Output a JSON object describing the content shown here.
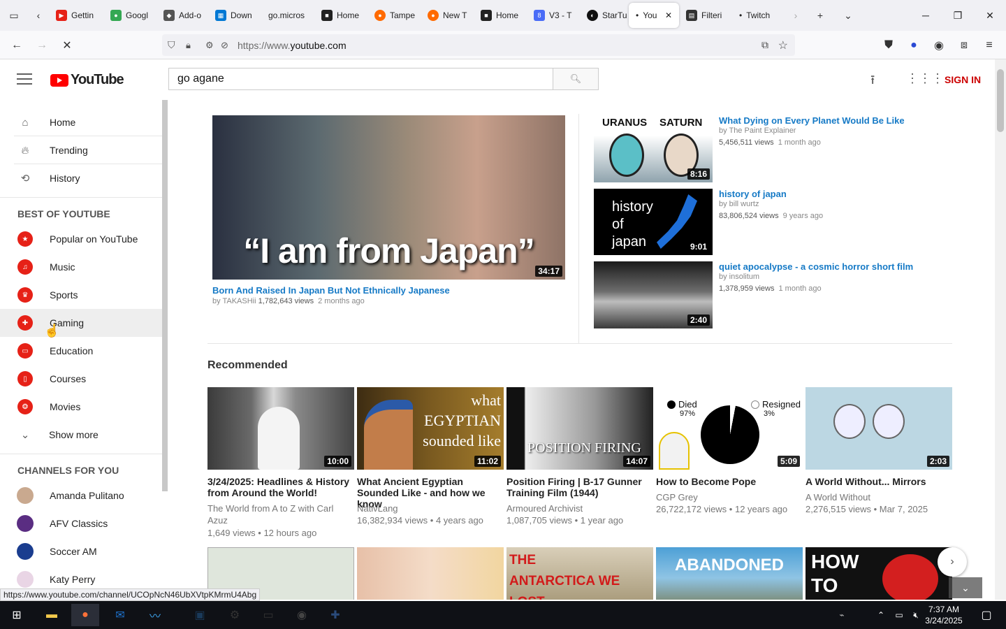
{
  "browser": {
    "tabs": [
      {
        "label": "Gettin",
        "color": "#e62117"
      },
      {
        "label": "Googl",
        "color": "#34a853"
      },
      {
        "label": "Add-o",
        "color": "#555555"
      },
      {
        "label": "Down",
        "color": "#0078d4"
      },
      {
        "label": "go.micros",
        "color": "#f0f0f4"
      },
      {
        "label": "Home",
        "color": "#222222"
      },
      {
        "label": "Tampe",
        "color": "#ff6a00"
      },
      {
        "label": "New T",
        "color": "#ff6a00"
      },
      {
        "label": "Home",
        "color": "#222222"
      },
      {
        "label": "V3 - T",
        "color": "#4a6cf7"
      },
      {
        "label": "StarTu",
        "color": "#111111"
      },
      {
        "label": "You",
        "color": "#f0f0f4"
      },
      {
        "label": "Filteri",
        "color": "#333333"
      },
      {
        "label": "Twitch",
        "color": "#f0f0f4"
      }
    ],
    "url_prefix": "https://www.",
    "url_domain": "youtube.com",
    "status_url": "https://www.youtube.com/channel/UCOpNcN46UbXVtpKMrmU4Abg"
  },
  "header": {
    "logo_text": "YouTube",
    "search_value": "go agane",
    "sign_in": "SIGN IN"
  },
  "sidebar": {
    "main_items": [
      {
        "label": "Home"
      },
      {
        "label": "Trending"
      },
      {
        "label": "History"
      }
    ],
    "best_heading": "BEST OF YOUTUBE",
    "best_items": [
      {
        "label": "Popular on YouTube"
      },
      {
        "label": "Music"
      },
      {
        "label": "Sports"
      },
      {
        "label": "Gaming"
      },
      {
        "label": "Education"
      },
      {
        "label": "Courses"
      },
      {
        "label": "Movies"
      }
    ],
    "show_more": "Show more",
    "channels_heading": "CHANNELS FOR YOU",
    "channels": [
      {
        "label": "Amanda Pulitano",
        "color": "#c9a98f"
      },
      {
        "label": "AFV Classics",
        "color": "#5a2d82"
      },
      {
        "label": "Soccer AM",
        "color": "#1a3d8f"
      },
      {
        "label": "Katy Perry",
        "color": "#e9d5e5"
      }
    ]
  },
  "featured": {
    "main": {
      "thumb_text": "“I am from Japan”",
      "duration": "34:17",
      "title": "Born And Raised In Japan But Not Ethnically Japanese",
      "channel": "by TAKASHii",
      "views": "1,782,643 views",
      "age": "2 months ago"
    },
    "side": [
      {
        "thumb_left": "URANUS",
        "thumb_right": "SATURN",
        "duration": "8:16",
        "title": "What Dying on Every Planet Would Be Like",
        "channel": "by The Paint Explainer",
        "views": "5,456,511 views",
        "age": "1 month ago"
      },
      {
        "thumb_text": "history of japan",
        "duration": "9:01",
        "title": "history of japan",
        "channel": "by bill wurtz",
        "views": "83,806,524 views",
        "age": "9 years ago"
      },
      {
        "duration": "2:40",
        "title": "quiet apocalypse - a cosmic horror short film",
        "channel": "by insolitum",
        "views": "1,378,959 views",
        "age": "1 month ago"
      }
    ]
  },
  "recommended": {
    "heading": "Recommended",
    "videos": [
      {
        "duration": "10:00",
        "title": "3/24/2025: Headlines & History from Around the World!",
        "channel": "The World from A to Z with Carl Azuz",
        "views": "1,649 views",
        "age": "12 hours ago"
      },
      {
        "duration": "11:02",
        "thumb_text": "what EGYPTIAN sounded like",
        "title": "What Ancient Egyptian Sounded Like - and how we know",
        "channel": "NativLang",
        "views": "16,382,934 views",
        "age": "4 years ago"
      },
      {
        "duration": "14:07",
        "thumb_text": "POSITION FIRING",
        "title": "Position Firing | B-17 Gunner Training Film (1944)",
        "channel": "Armoured Archivist",
        "views": "1,087,705 views",
        "age": "1 year ago"
      },
      {
        "duration": "5:09",
        "thumb_died": "Died",
        "thumb_died_pct": "97%",
        "thumb_res": "Resigned",
        "thumb_res_pct": "3%",
        "title": "How to Become Pope",
        "channel": "CGP Grey",
        "views": "26,722,172 views",
        "age": "12 years ago"
      },
      {
        "duration": "2:03",
        "title": "A World Without... Mirrors",
        "channel": "A World Without",
        "views": "2,276,515 views",
        "age": "Mar 7, 2025"
      }
    ],
    "row2_text": [
      "",
      "",
      "THE ANTARCTICA WE LOST",
      "ABANDONED",
      "HOW TO KILL A"
    ]
  },
  "taskbar": {
    "time": "7:37 AM",
    "date": "3/24/2025"
  }
}
